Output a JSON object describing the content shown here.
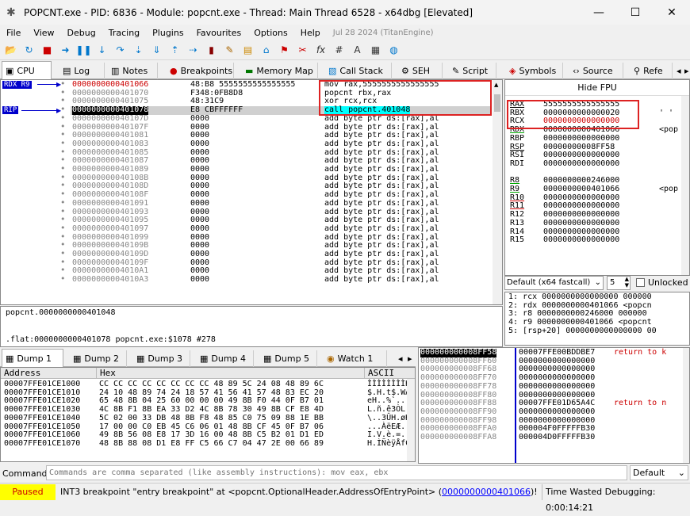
{
  "title": "POPCNT.exe - PID: 6836 - Module: popcnt.exe - Thread: Main Thread 6528 - x64dbg [Elevated]",
  "menu": [
    "File",
    "View",
    "Debug",
    "Tracing",
    "Plugins",
    "Favourites",
    "Options",
    "Help"
  ],
  "menu_date": "Jul 28 2024 (TitanEngine)",
  "tabs": [
    "CPU",
    "Log",
    "Notes",
    "Breakpoints",
    "Memory Map",
    "Call Stack",
    "SEH",
    "Script",
    "Symbols",
    "Source",
    "Refe"
  ],
  "labels": {
    "rdx_r9": "RDX R9",
    "rip": "RIP"
  },
  "disasm": [
    {
      "addr": "0000000000401066",
      "bytes": "48:B8 5555555555555555",
      "instr": "mov rax,5555555555555555",
      "hl": "red"
    },
    {
      "addr": "0000000000401070",
      "bytes": "F348:0FB8D8",
      "instr": "popcnt rbx,rax",
      "hl": "none"
    },
    {
      "addr": "0000000000401075",
      "bytes": "48:31C9",
      "instr": "xor rcx,rcx",
      "hl": "none"
    },
    {
      "addr": "0000000000401078",
      "bytes": "E8 CBFFFFFF",
      "instr": "call popcnt.401048",
      "hl": "rip"
    },
    {
      "addr": "000000000040107D",
      "bytes": "0000",
      "instr": "add byte ptr ds:[rax],al"
    },
    {
      "addr": "000000000040107F",
      "bytes": "0000",
      "instr": "add byte ptr ds:[rax],al"
    },
    {
      "addr": "0000000000401081",
      "bytes": "0000",
      "instr": "add byte ptr ds:[rax],al"
    },
    {
      "addr": "0000000000401083",
      "bytes": "0000",
      "instr": "add byte ptr ds:[rax],al"
    },
    {
      "addr": "0000000000401085",
      "bytes": "0000",
      "instr": "add byte ptr ds:[rax],al"
    },
    {
      "addr": "0000000000401087",
      "bytes": "0000",
      "instr": "add byte ptr ds:[rax],al"
    },
    {
      "addr": "0000000000401089",
      "bytes": "0000",
      "instr": "add byte ptr ds:[rax],al"
    },
    {
      "addr": "000000000040108B",
      "bytes": "0000",
      "instr": "add byte ptr ds:[rax],al"
    },
    {
      "addr": "000000000040108D",
      "bytes": "0000",
      "instr": "add byte ptr ds:[rax],al"
    },
    {
      "addr": "000000000040108F",
      "bytes": "0000",
      "instr": "add byte ptr ds:[rax],al"
    },
    {
      "addr": "0000000000401091",
      "bytes": "0000",
      "instr": "add byte ptr ds:[rax],al"
    },
    {
      "addr": "0000000000401093",
      "bytes": "0000",
      "instr": "add byte ptr ds:[rax],al"
    },
    {
      "addr": "0000000000401095",
      "bytes": "0000",
      "instr": "add byte ptr ds:[rax],al"
    },
    {
      "addr": "0000000000401097",
      "bytes": "0000",
      "instr": "add byte ptr ds:[rax],al"
    },
    {
      "addr": "0000000000401099",
      "bytes": "0000",
      "instr": "add byte ptr ds:[rax],al"
    },
    {
      "addr": "000000000040109B",
      "bytes": "0000",
      "instr": "add byte ptr ds:[rax],al"
    },
    {
      "addr": "000000000040109D",
      "bytes": "0000",
      "instr": "add byte ptr ds:[rax],al"
    },
    {
      "addr": "000000000040109F",
      "bytes": "0000",
      "instr": "add byte ptr ds:[rax],al"
    },
    {
      "addr": "00000000004010A1",
      "bytes": "0000",
      "instr": "add byte ptr ds:[rax],al"
    },
    {
      "addr": "00000000004010A3",
      "bytes": "0000",
      "instr": "add byte ptr ds:[rax],al"
    }
  ],
  "hide_fpu": "Hide FPU",
  "registers": [
    {
      "n": "RAX",
      "v": "5555555555555555",
      "extra": "",
      "c": "chg"
    },
    {
      "n": "RBX",
      "v": "0000000000000020",
      "extra": "' '",
      "c": "chg"
    },
    {
      "n": "RCX",
      "v": "0000000000000000",
      "extra": "",
      "c": "chg"
    },
    {
      "n": "RDX",
      "v": "0000000000401066",
      "extra": "<pop",
      "c": ""
    },
    {
      "n": "RBP",
      "v": "0000000000000000",
      "extra": "",
      "c": ""
    },
    {
      "n": "RSP",
      "v": "00000000008FF58",
      "extra": "",
      "c": ""
    },
    {
      "n": "RSI",
      "v": "0000000000000000",
      "extra": "",
      "c": ""
    },
    {
      "n": "RDI",
      "v": "0000000000000000",
      "extra": "",
      "c": ""
    },
    {
      "n": "",
      "v": "",
      "extra": "",
      "c": ""
    },
    {
      "n": "R8",
      "v": "0000000000246000",
      "extra": "",
      "c": ""
    },
    {
      "n": "R9",
      "v": "0000000000401066",
      "extra": "<pop",
      "c": ""
    },
    {
      "n": "R10",
      "v": "0000000000000000",
      "extra": "",
      "c": ""
    },
    {
      "n": "R11",
      "v": "0000000000000000",
      "extra": "",
      "c": ""
    },
    {
      "n": "R12",
      "v": "0000000000000000",
      "extra": "",
      "c": ""
    },
    {
      "n": "R13",
      "v": "0000000000000000",
      "extra": "",
      "c": ""
    },
    {
      "n": "R14",
      "v": "0000000000000000",
      "extra": "",
      "c": ""
    },
    {
      "n": "R15",
      "v": "0000000000000000",
      "extra": "",
      "c": ""
    }
  ],
  "callconv": {
    "value": "Default (x64 fastcall)",
    "count": "5",
    "unlocked": "Unlocked"
  },
  "args": [
    "1: rcx 0000000000000000 000000",
    "2: rdx 0000000000401066 <popcn",
    "3: r8 0000000000246000 000000",
    "4: r9 0000000000401066 <popcnt",
    "5: [rsp+20] 0000000000000000 00"
  ],
  "info": [
    "popcnt.0000000000401048",
    "",
    ".flat:0000000000401078 popcnt.exe:$1078 #278"
  ],
  "dumptabs": [
    "Dump 1",
    "Dump 2",
    "Dump 3",
    "Dump 4",
    "Dump 5",
    "Watch 1"
  ],
  "dump_headers": {
    "addr": "Address",
    "hex": "Hex",
    "ascii": "ASCII"
  },
  "dump": [
    {
      "a": "00007FFE01CE1000",
      "h": "CC CC CC CC CC CC CC CC 48 89 5C 24 08 48 89 6C",
      "s": "ÌÌÌÌÌÌÌÌH.\\$.H.l"
    },
    {
      "a": "00007FFE01CE1010",
      "h": "24 10 48 89 74 24 18 57 41 56 41 57 48 83 EC 20",
      "s": "$.H.t$.WAVAWH.ì "
    },
    {
      "a": "00007FFE01CE1020",
      "h": "65 48 8B 04 25 60 00 00 00 49 8B F0 44 0F B7 01",
      "s": "eH..%`...I.ðD.·."
    },
    {
      "a": "00007FFE01CE1030",
      "h": "4C 8B F1 8B EA 33 D2 4C 8B 78 30 49 8B CF E8 4D",
      "s": "L.ñ.ê3ÒL.x0I.ÏèM"
    },
    {
      "a": "00007FFE01CE1040",
      "h": "5C 02 00 33 DB 48 8B F8 48 85 C0 75 09 88 1E BB",
      "s": "\\..3ÛH.øH.Àu...»"
    },
    {
      "a": "00007FFE01CE1050",
      "h": "17 00 00 C0 EB 45 C6 06 01 48 8B CF 45 0F B7 06",
      "s": "...ÀëEÆ..H.ÏE.·."
    },
    {
      "a": "00007FFE01CE1060",
      "h": "49 8B 56 08 E8 17 3D 16 00 48 8B C5 B2 01 D1 ED",
      "s": "I.V.è.=..H.Å².Ñí"
    },
    {
      "a": "00007FFE01CE1070",
      "h": "48 8B 88 08 D1 E8 FF C5 66 C7 04 47 2E 00 66 89",
      "s": "H.ÌÑèÿÅfÇ.G..f."
    }
  ],
  "stack": [
    {
      "a": "000000000008FF58",
      "v": "00007FFE00BDDBE7",
      "c": "return to k"
    },
    {
      "a": "000000000008FF60",
      "v": "0000000000000000",
      "c": ""
    },
    {
      "a": "000000000008FF68",
      "v": "0000000000000000",
      "c": ""
    },
    {
      "a": "000000000008FF70",
      "v": "0000000000000000",
      "c": ""
    },
    {
      "a": "000000000008FF78",
      "v": "0000000000000000",
      "c": ""
    },
    {
      "a": "000000000008FF80",
      "v": "0000000000000000",
      "c": ""
    },
    {
      "a": "000000000008FF88",
      "v": "00007FFE01D65A4C",
      "c": "return to n"
    },
    {
      "a": "000000000008FF90",
      "v": "0000000000000000",
      "c": ""
    },
    {
      "a": "000000000008FF98",
      "v": "0000000000000000",
      "c": ""
    },
    {
      "a": "000000000008FFA0",
      "v": "000004F0FFFFFB30",
      "c": ""
    },
    {
      "a": "000000000008FFA8",
      "v": "000004D0FFFFFB30",
      "c": ""
    }
  ],
  "cmd": {
    "label": "Command:",
    "placeholder": "Commands are comma separated (like assembly instructions): mov eax, ebx",
    "mode": "Default"
  },
  "status": {
    "state": "Paused",
    "msg": "INT3 breakpoint \"entry breakpoint\" at <popcnt.OptionalHeader.AddressOfEntryPoint> (",
    "link": "0000000000401066",
    "end": ")!",
    "time": "Time Wasted Debugging: 0:00:14:21"
  }
}
